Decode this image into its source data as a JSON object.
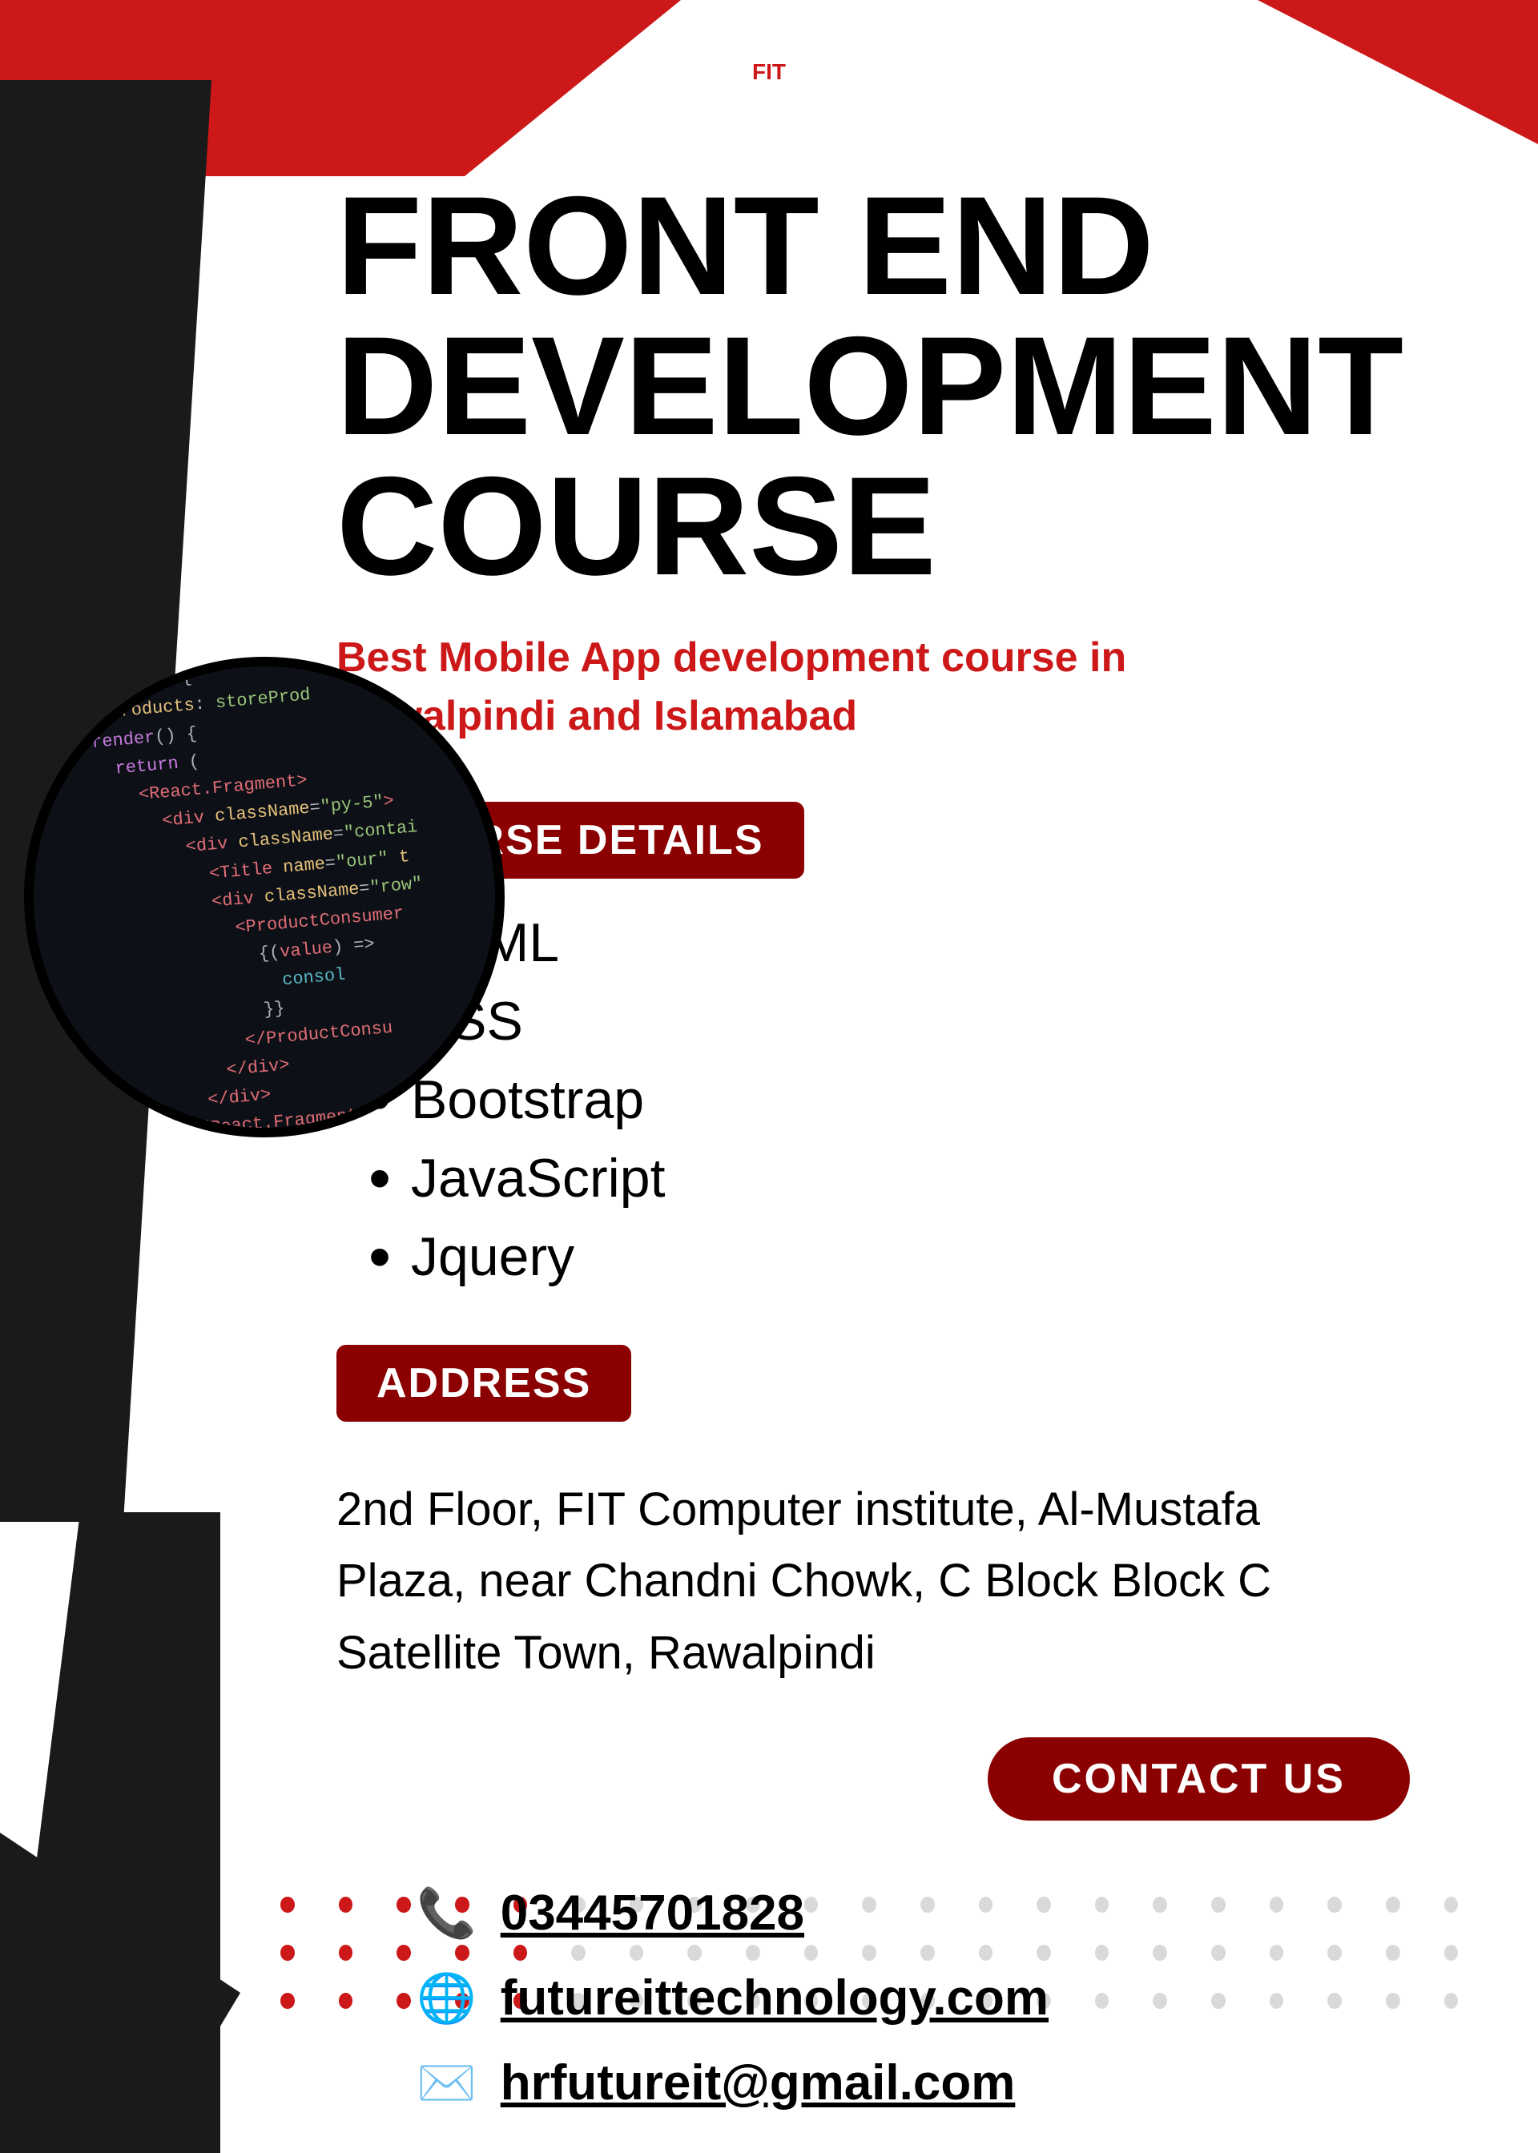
{
  "header": {
    "logo_text": "FIT"
  },
  "title": {
    "line1": "FRONT END",
    "line2": "DEVELOPMENT",
    "line3": "COURSE"
  },
  "subtitle": "Best Mobile App development course in Rawalpindi and Islamabad",
  "course_details": {
    "badge_label": "COURSE DETAILS",
    "items": [
      {
        "label": "HTML"
      },
      {
        "label": "CSS"
      },
      {
        "label": "Bootstrap"
      },
      {
        "label": "JavaScript"
      },
      {
        "label": "Jquery"
      }
    ]
  },
  "address": {
    "badge_label": "ADDRESS",
    "text": "2nd Floor, FIT Computer institute, Al-Mustafa Plaza, near Chandni Chowk, C Block Block C Satellite Town, Rawalpindi"
  },
  "contact_us": {
    "button_label": "CONTACT US",
    "phone": "03445701828",
    "website": "futureittechnology.com",
    "email": "hrfutureit@gmail.com"
  },
  "code_snippet": "react{\n  products: storeProd\nrender() {\n  return (\n    <React.Fragment>\n      <div className=\"py-5\">\n        <div className=\"contai\n          <Title name=\"our\" t\n          <div className=\"row\"\n            <ProductConsumer\n              {(value) =>\n                consol\n              }}\n            </ProductConsu\n          </div>\n        </div>\n      </React.Fragment>\n    )\n  }\n}",
  "colors": {
    "red": "#cc1818",
    "dark_red": "#8b0000",
    "black": "#1a1a1a",
    "white": "#ffffff"
  }
}
